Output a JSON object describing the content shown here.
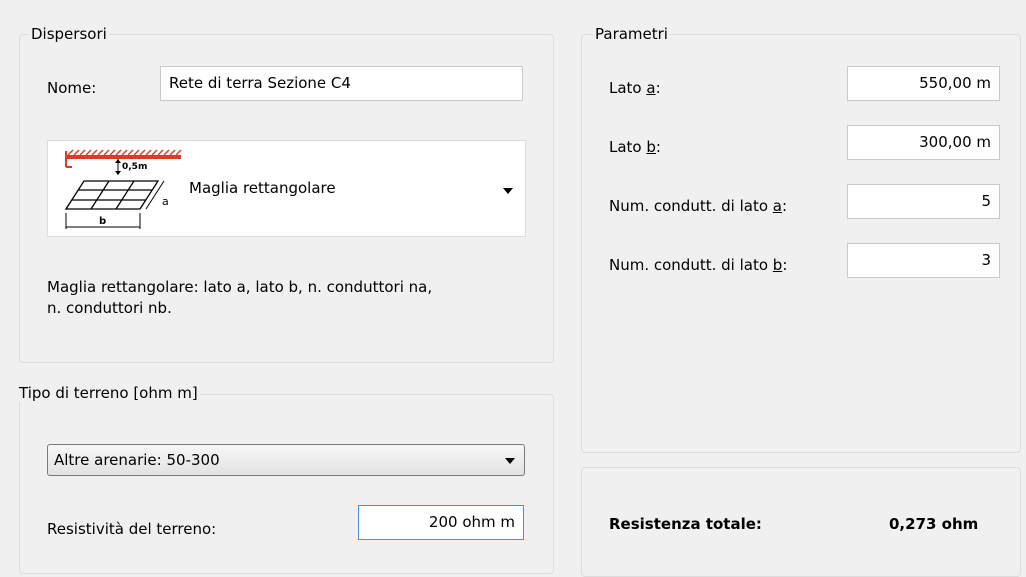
{
  "dispersori": {
    "legend": "Dispersori",
    "name_label": "Nome:",
    "name_value": "Rete di terra Sezione C4",
    "type_selected": "Maglia rettangolare",
    "diagram_label_depth": "0,5m",
    "diagram_label_a": "a",
    "diagram_label_b": "b",
    "description_line1": "Maglia rettangolare: lato a, lato b, n. conduttori na,",
    "description_line2": "n. conduttori nb."
  },
  "terreno": {
    "legend": "Tipo di terreno [ohm m]",
    "selected": "Altre arenarie: 50-300",
    "resistivity_label": "Resistività del terreno:",
    "resistivity_value": "200 ohm m"
  },
  "parametri": {
    "legend": "Parametri",
    "rows": [
      {
        "label_prefix": "Lato ",
        "label_key": "a",
        "label_suffix": ":",
        "value": "550,00 m"
      },
      {
        "label_prefix": "Lato ",
        "label_key": "b",
        "label_suffix": ":",
        "value": "300,00 m"
      },
      {
        "label_prefix": "Num. condutt. di lato ",
        "label_key": "a",
        "label_suffix": ":",
        "value": "5"
      },
      {
        "label_prefix": "Num. condutt. di lato ",
        "label_key": "b",
        "label_suffix": ":",
        "value": "3"
      }
    ]
  },
  "risultato": {
    "label": "Resistenza totale:",
    "value": "0,273 ohm"
  }
}
